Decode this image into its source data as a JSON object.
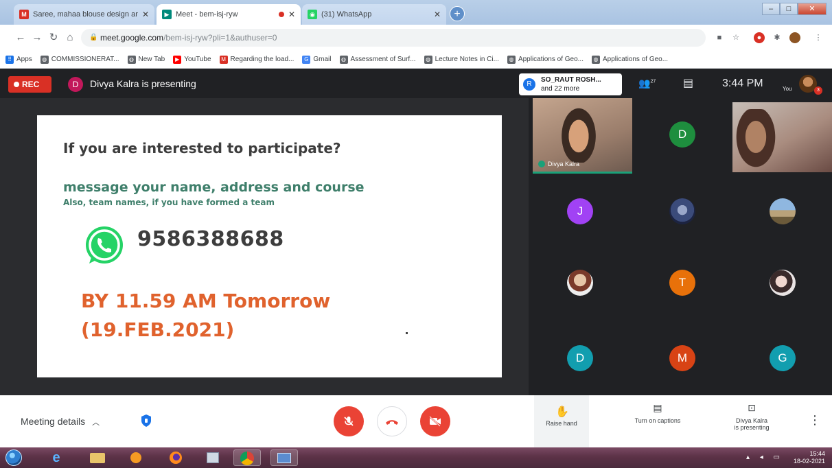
{
  "browser": {
    "tabs": [
      {
        "title": "Saree, mahaa blouse design an",
        "favicon": "gmail-icon",
        "favicon_color": "#d93025"
      },
      {
        "title": "Meet - bem-isj-ryw",
        "favicon": "meet-icon",
        "favicon_color": "#00897b"
      },
      {
        "title": "(31) WhatsApp",
        "favicon": "whatsapp-icon",
        "favicon_color": "#25d366"
      }
    ],
    "url_host": "meet.google.com",
    "url_path": "/bem-isj-ryw?pli=1&authuser=0",
    "bookmarks": [
      "Apps",
      "COMMISSIONERAT...",
      "New Tab",
      "YouTube",
      "Regarding the load...",
      "Gmail",
      "Assessment of Surf...",
      "Lecture Notes in Ci...",
      "Applications of Geo...",
      "Applications of Geo..."
    ]
  },
  "meet": {
    "rec_label": "REC",
    "presenter_initial": "D",
    "presenting_text": "Divya Kalra is presenting",
    "people_chip_initial": "R",
    "people_chip_line1": "SO_RAUT ROSH...",
    "people_chip_line2": "and 22 more",
    "people_count": "27",
    "clock": "3:44 PM",
    "self_label": "You",
    "self_badge": "3"
  },
  "slide": {
    "question": "If you are interested to participate?",
    "message": "message your name, address and course",
    "team_note": "Also, team names, if you have formed a team",
    "phone": "9586388688",
    "deadline_line1": "BY 11.59 AM Tomorrow",
    "deadline_line2": "(19.FEB.2021)"
  },
  "participants": {
    "main_tile_name": "Divya Kalra",
    "tiles": [
      {
        "initial": "D",
        "color": "#1e8e3e"
      },
      {
        "initial": "J",
        "color": "#a142f4"
      },
      {
        "initial": "T",
        "color": "#e8710a"
      },
      {
        "initial": "D",
        "color": "#129eaf"
      },
      {
        "initial": "M",
        "color": "#d84315"
      },
      {
        "initial": "G",
        "color": "#129eaf"
      }
    ]
  },
  "controls": {
    "meeting_details": "Meeting details",
    "raise_hand": "Raise hand",
    "captions": "Turn on captions",
    "presenting_line1": "Divya Kalra",
    "presenting_line2": "is presenting"
  },
  "taskbar": {
    "time": "15:44",
    "date": "18-02-2021"
  },
  "colors": {
    "rec_red": "#d93025",
    "meet_dark": "#202124",
    "slide_green": "#3f7f6b",
    "slide_orange": "#e0622d",
    "whatsapp_green": "#25d366"
  }
}
